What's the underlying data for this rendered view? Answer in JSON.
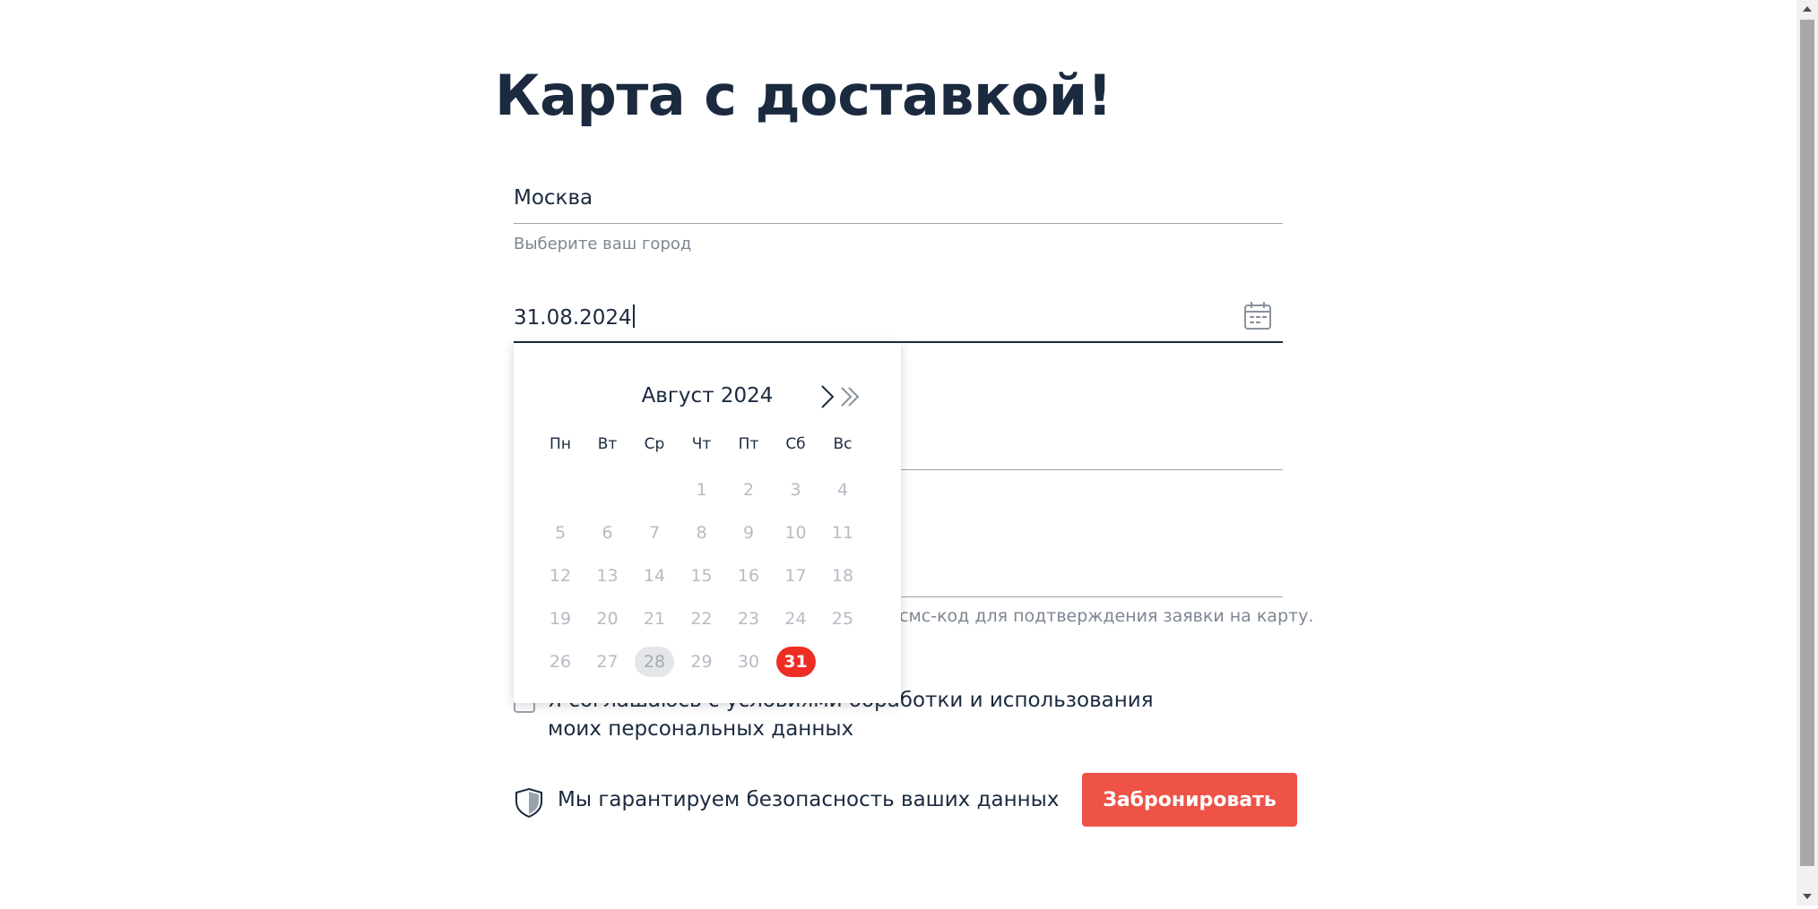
{
  "page": {
    "title": "Карта с доставкой!"
  },
  "city": {
    "value": "Москва",
    "hint": "Выберите ваш город"
  },
  "date": {
    "value": "31.08.2024"
  },
  "sms_hint": "смс-код для подтверждения заявки на карту.",
  "consent": {
    "text": "Я соглашаюсь с условиями обработки и использования моих персональных данных"
  },
  "security": {
    "text": "Мы гарантируем безопасность ваших данных",
    "icon": "shield-icon"
  },
  "submit": {
    "label": "Забронировать"
  },
  "calendar": {
    "month_label": "Август 2024",
    "weekdays": [
      "Пн",
      "Вт",
      "Ср",
      "Чт",
      "Пт",
      "Сб",
      "Вс"
    ],
    "weeks": [
      [
        "",
        "",
        "",
        "1",
        "2",
        "3",
        "4"
      ],
      [
        "5",
        "6",
        "7",
        "8",
        "9",
        "10",
        "11"
      ],
      [
        "12",
        "13",
        "14",
        "15",
        "16",
        "17",
        "18"
      ],
      [
        "19",
        "20",
        "21",
        "22",
        "23",
        "24",
        "25"
      ],
      [
        "26",
        "27",
        "28",
        "29",
        "30",
        "31",
        ""
      ]
    ],
    "today": "28",
    "selected": "31"
  },
  "colors": {
    "accent": "#ef5246",
    "selected_day": "#ee2e24",
    "text": "#1b2a3f",
    "muted": "#7d8793"
  }
}
